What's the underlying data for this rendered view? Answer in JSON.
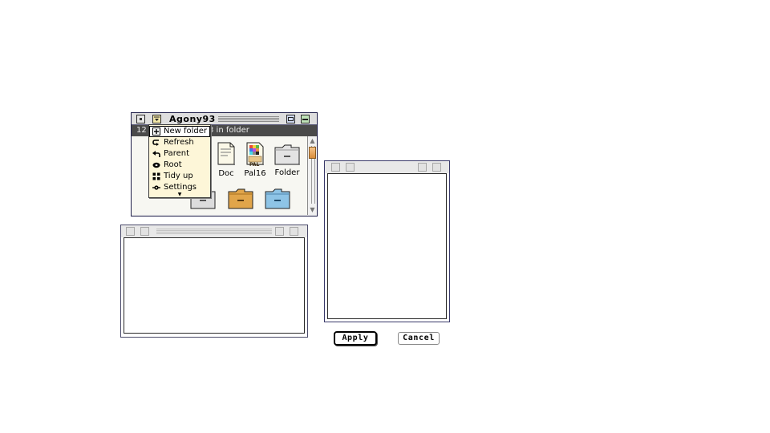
{
  "finder": {
    "title": "Agony93",
    "info_prefix": "12",
    "info_suffix": "3 in folder",
    "icons": [
      {
        "label": "Doc",
        "icon": "document-icon"
      },
      {
        "label": "Pal16",
        "icon": "palette-file-icon",
        "badge": "PAL"
      },
      {
        "label": "Folder",
        "icon": "folder-icon"
      }
    ]
  },
  "menu": {
    "items": [
      {
        "label": "New folder",
        "icon": "new-folder-icon"
      },
      {
        "label": "Refresh",
        "icon": "refresh-icon"
      },
      {
        "label": "Parent",
        "icon": "parent-arrow-icon"
      },
      {
        "label": "Root",
        "icon": "root-icon"
      },
      {
        "label": "Tidy up",
        "icon": "tidy-up-icon"
      },
      {
        "label": "Settings",
        "icon": "settings-icon"
      }
    ],
    "more_glyph": "▼"
  },
  "buttons": {
    "apply": "Apply",
    "cancel": "Cancel"
  },
  "colors": {
    "accent_orange": "#e1a54a",
    "folder_blue": "#8ec4e6",
    "folder_gray": "#dcdcdc",
    "scroll_thumb": "#d98c3b"
  }
}
